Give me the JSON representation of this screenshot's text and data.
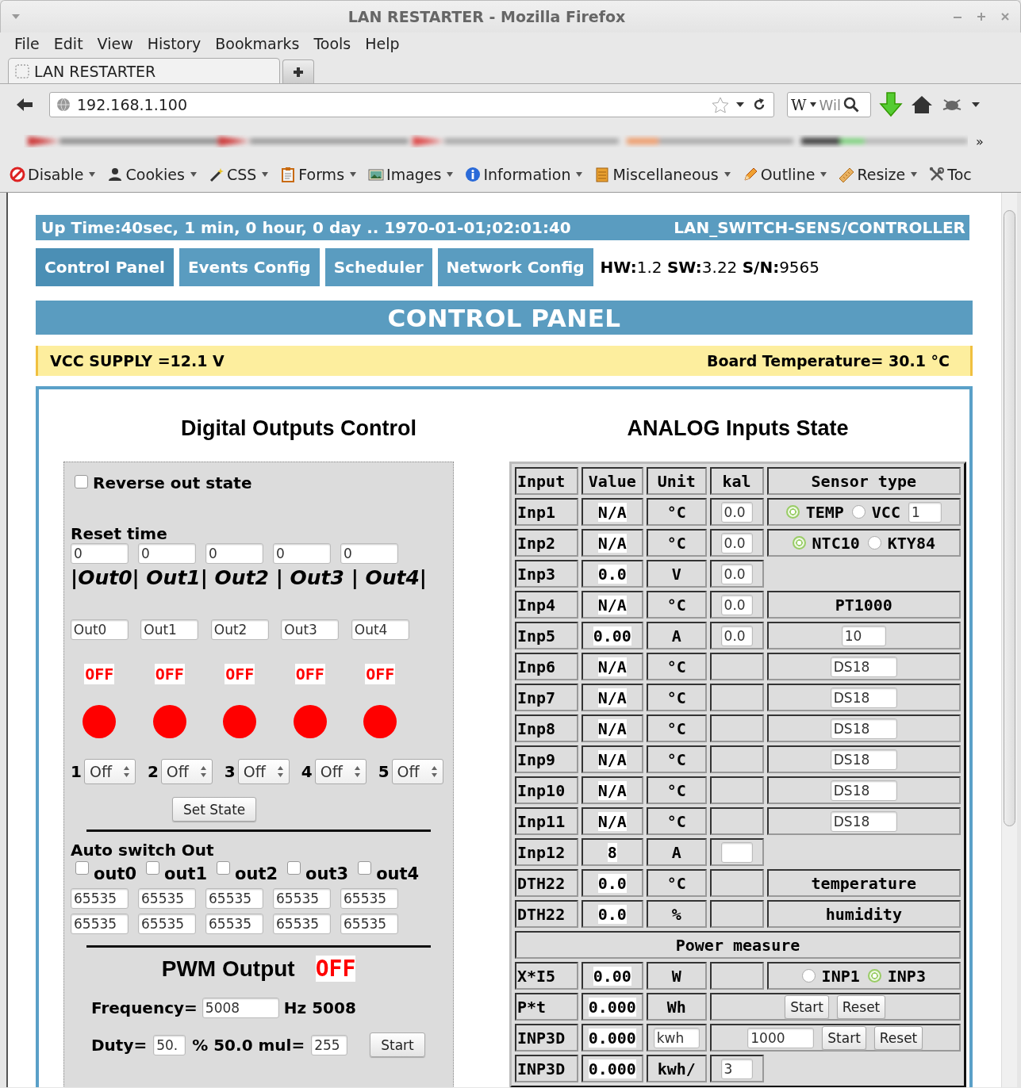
{
  "window": {
    "title": "LAN RESTARTER - Mozilla Firefox"
  },
  "menu": [
    "File",
    "Edit",
    "View",
    "History",
    "Bookmarks",
    "Tools",
    "Help"
  ],
  "tab": {
    "title": "LAN RESTARTER"
  },
  "address": {
    "url": "192.168.1.100"
  },
  "search": {
    "engine": "W",
    "placeholder": "Wil"
  },
  "bookmarks": {
    "overflow": "»"
  },
  "dev_toolbar": [
    {
      "kind": "disable",
      "label": "Disable",
      "menu": true
    },
    {
      "kind": "cookies",
      "label": "Cookies",
      "menu": true
    },
    {
      "kind": "css",
      "label": "CSS",
      "menu": true
    },
    {
      "kind": "forms",
      "label": "Forms",
      "menu": true
    },
    {
      "kind": "images",
      "label": "Images",
      "menu": true
    },
    {
      "kind": "information",
      "label": "Information",
      "menu": true
    },
    {
      "kind": "miscellaneous",
      "label": "Miscellaneous",
      "menu": true
    },
    {
      "kind": "outline",
      "label": "Outline",
      "menu": true
    },
    {
      "kind": "resize",
      "label": "Resize",
      "menu": true
    },
    {
      "kind": "tools",
      "label": "Toc",
      "menu": false
    }
  ],
  "header": {
    "uptime": "Up Time:40sec, 1 min, 0 hour, 0 day .. 1970-01-01;02:01:40",
    "device": "LAN_SWITCH-SENS/CONTROLLER"
  },
  "nav": [
    {
      "label": "Control Panel",
      "selected": true
    },
    {
      "label": "Events Config",
      "selected": false
    },
    {
      "label": "Scheduler",
      "selected": false
    },
    {
      "label": "Network Config",
      "selected": false
    }
  ],
  "versions": "**HW:**1.2 **SW:**3.22 **S/N:**9565",
  "title": "CONTROL PANEL",
  "supply": {
    "vcc": "VCC SUPPLY =12.1 V",
    "temperature": "Board Temperature= 30.1 °C"
  },
  "outputs_panel": {
    "heading": "Digital Outputs Control",
    "reverse": {
      "label": "Reverse out state",
      "checked": false
    },
    "reset_time": {
      "label": "Reset time",
      "values": [
        "0",
        "0",
        "0",
        "0",
        "0"
      ]
    },
    "outputs_label": "|Out0| Out1| Out2 | Out3 | Out4|",
    "names": [
      "Out0",
      "Out1",
      "Out2",
      "Out3",
      "Out4"
    ],
    "outputs": [
      {
        "status": "OFF",
        "on": false
      },
      {
        "status": "OFF",
        "on": false
      },
      {
        "status": "OFF",
        "on": false
      },
      {
        "status": "OFF",
        "on": false
      },
      {
        "status": "OFF",
        "on": false
      }
    ],
    "modes": [
      {
        "number": "1",
        "value": "Off"
      },
      {
        "number": "2",
        "value": "Off"
      },
      {
        "number": "3",
        "value": "Off"
      },
      {
        "number": "4",
        "value": "Off"
      },
      {
        "number": "5",
        "value": "Off"
      }
    ],
    "set_state": "Set State",
    "auto_switch": {
      "label": "Auto switch Out",
      "outputs": [
        {
          "label": "out0",
          "checked": false
        },
        {
          "label": "out1",
          "checked": false
        },
        {
          "label": "out2",
          "checked": false
        },
        {
          "label": "out3",
          "checked": false
        },
        {
          "label": "out4",
          "checked": false
        }
      ],
      "rows": [
        [
          "65535",
          "65535",
          "65535",
          "65535",
          "65535"
        ],
        [
          "65535",
          "65535",
          "65535",
          "65535",
          "65535"
        ]
      ]
    },
    "pwm": {
      "label": "PWM Output",
      "status": "OFF",
      "on": false,
      "frequency_label": "Frequency=",
      "frequency": "5008",
      "frequency_suffix": "Hz 5008",
      "duty_label": "Duty=",
      "duty": "50.",
      "duty_suffix": "% 50.0 mul=",
      "mul": "255",
      "start": "Start"
    }
  },
  "analog": {
    "heading": "ANALOG Inputs State",
    "columns": [
      "Input",
      "Value",
      "Unit",
      "kal",
      "Sensor type"
    ],
    "rows": [
      {
        "input": "Inp1",
        "value": "N/A",
        "unit": {
          "kind": "text",
          "text": "°C"
        },
        "kal": {
          "kind": "field",
          "value": "0.0"
        },
        "sensor": {
          "kind": "controls",
          "items": [
            {
              "kind": "radio",
              "label": "TEMP",
              "selected": true
            },
            {
              "kind": "radio",
              "label": "VCC",
              "selected": false
            },
            {
              "kind": "field",
              "value": "1"
            }
          ]
        }
      },
      {
        "input": "Inp2",
        "value": "N/A",
        "unit": {
          "kind": "text",
          "text": "°C"
        },
        "kal": {
          "kind": "field",
          "value": "0.0"
        },
        "sensor": {
          "kind": "controls",
          "items": [
            {
              "kind": "radio",
              "label": "NTC10",
              "selected": true
            },
            {
              "kind": "radio",
              "label": "KTY84",
              "selected": false
            }
          ]
        }
      },
      {
        "input": "Inp3",
        "value": "0.0",
        "unit": {
          "kind": "text",
          "text": "V"
        },
        "kal": {
          "kind": "field",
          "value": "0.0"
        }
      },
      {
        "input": "Inp4",
        "value": "N/A",
        "unit": {
          "kind": "text",
          "text": "°C"
        },
        "kal": {
          "kind": "field",
          "value": "0.0"
        },
        "sensor": {
          "kind": "text",
          "text": "PT1000"
        }
      },
      {
        "input": "Inp5",
        "value": "0.00",
        "unit": {
          "kind": "text",
          "text": "A"
        },
        "kal": {
          "kind": "field",
          "value": "0.0"
        },
        "sensor": {
          "kind": "controls",
          "items": [
            {
              "kind": "field",
              "value": "10"
            }
          ]
        }
      },
      {
        "input": "Inp6",
        "value": "N/A",
        "unit": {
          "kind": "text",
          "text": "°C"
        },
        "kal": {
          "kind": "blank"
        },
        "sensor": {
          "kind": "controls",
          "items": [
            {
              "kind": "field",
              "value": "DS18"
            }
          ]
        }
      },
      {
        "input": "Inp7",
        "value": "N/A",
        "unit": {
          "kind": "text",
          "text": "°C"
        },
        "kal": {
          "kind": "blank"
        },
        "sensor": {
          "kind": "controls",
          "items": [
            {
              "kind": "field",
              "value": "DS18"
            }
          ]
        }
      },
      {
        "input": "Inp8",
        "value": "N/A",
        "unit": {
          "kind": "text",
          "text": "°C"
        },
        "kal": {
          "kind": "blank"
        },
        "sensor": {
          "kind": "controls",
          "items": [
            {
              "kind": "field",
              "value": "DS18"
            }
          ]
        }
      },
      {
        "input": "Inp9",
        "value": "N/A",
        "unit": {
          "kind": "text",
          "text": "°C"
        },
        "kal": {
          "kind": "blank"
        },
        "sensor": {
          "kind": "controls",
          "items": [
            {
              "kind": "field",
              "value": "DS18"
            }
          ]
        }
      },
      {
        "input": "Inp10",
        "value": "N/A",
        "unit": {
          "kind": "text",
          "text": "°C"
        },
        "kal": {
          "kind": "blank"
        },
        "sensor": {
          "kind": "controls",
          "items": [
            {
              "kind": "field",
              "value": "DS18"
            }
          ]
        }
      },
      {
        "input": "Inp11",
        "value": "N/A",
        "unit": {
          "kind": "text",
          "text": "°C"
        },
        "kal": {
          "kind": "blank"
        },
        "sensor": {
          "kind": "controls",
          "items": [
            {
              "kind": "field",
              "value": "DS18"
            }
          ]
        }
      },
      {
        "input": "Inp12",
        "value": "8",
        "unit": {
          "kind": "text",
          "text": "A"
        },
        "kal": {
          "kind": "field"
        }
      },
      {
        "input": "DTH22",
        "value": "0.0",
        "unit": {
          "kind": "text",
          "text": "°C"
        },
        "kal": {
          "kind": "blank"
        },
        "sensor": {
          "kind": "text",
          "text": "temperature"
        }
      },
      {
        "input": "DTH22",
        "value": "0.0",
        "unit": {
          "kind": "text",
          "text": "%"
        },
        "kal": {
          "kind": "blank"
        },
        "sensor": {
          "kind": "text",
          "text": "humidity"
        }
      },
      {
        "kind": "section",
        "label": "Power measure"
      },
      {
        "input": "X*I5",
        "value": "0.00",
        "unit": {
          "kind": "text",
          "text": "W"
        },
        "kal": {
          "kind": "blank"
        },
        "sensor": {
          "kind": "controls",
          "items": [
            {
              "kind": "radio",
              "label": "INP1",
              "selected": false
            },
            {
              "kind": "radio",
              "label": "INP3",
              "selected": true
            }
          ]
        }
      },
      {
        "input": "P*t",
        "value": "0.000",
        "unit": {
          "kind": "text",
          "text": "Wh"
        },
        "kal": {
          "kind": "none"
        },
        "sensor": {
          "kind": "controls",
          "items": [
            {
              "kind": "button",
              "label": "Start"
            },
            {
              "kind": "button",
              "label": "Reset"
            }
          ]
        }
      },
      {
        "input": "INP3D",
        "value": "0.000",
        "unit": {
          "kind": "field",
          "text": "kwh"
        },
        "kal": {
          "kind": "none"
        },
        "sensor": {
          "kind": "controls",
          "items": [
            {
              "kind": "field",
              "value": "1000"
            },
            {
              "kind": "button",
              "label": "Start"
            },
            {
              "kind": "button",
              "label": "Reset"
            }
          ]
        }
      },
      {
        "input": "INP3D",
        "value": "0.000",
        "unit": {
          "kind": "text",
          "text": "kwh/"
        },
        "kal": {
          "kind": "field",
          "value": "3"
        }
      }
    ]
  }
}
